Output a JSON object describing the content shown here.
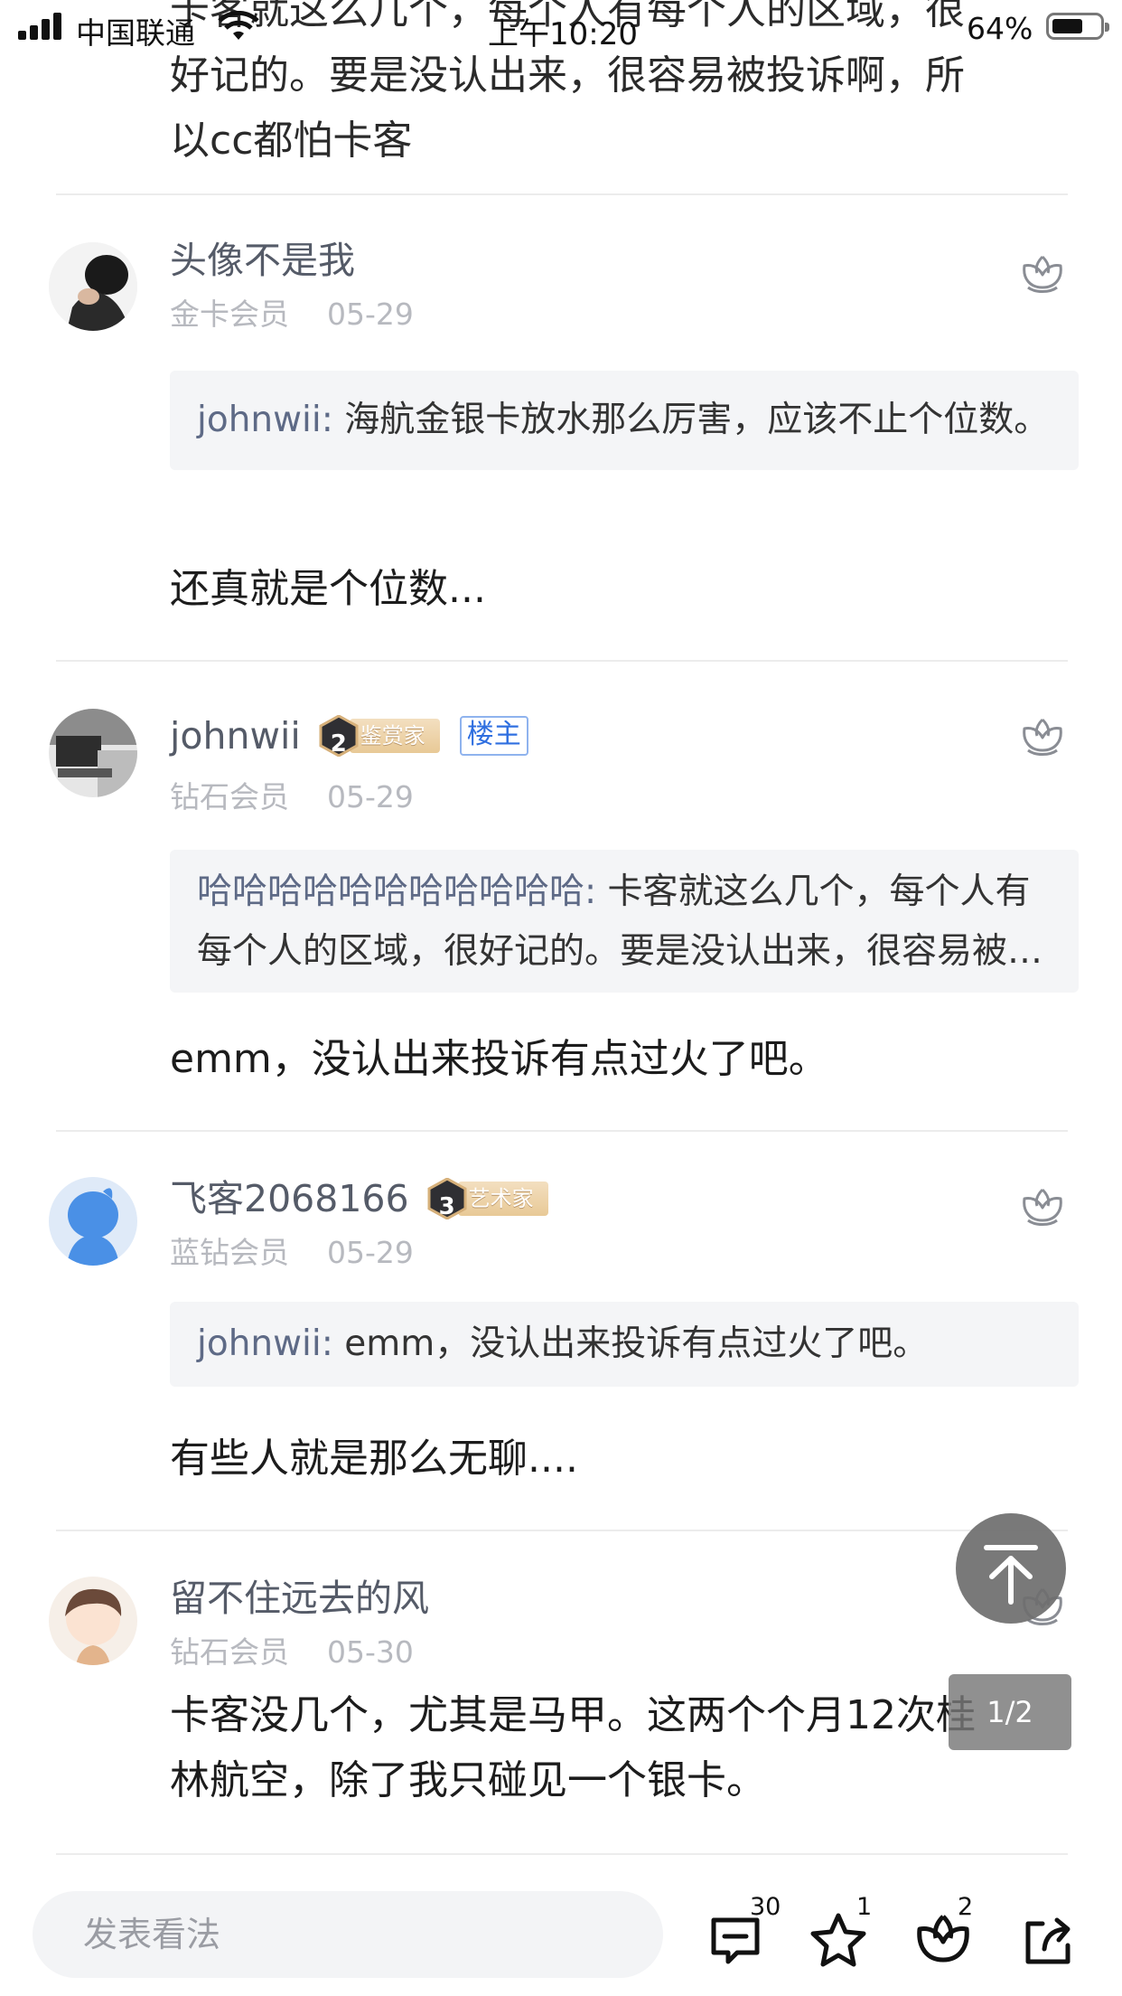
{
  "status_bar": {
    "carrier": "中国联通",
    "time": "上午10:20",
    "battery": "64%",
    "battery_level": 0.64
  },
  "top_fragment": {
    "line1": "卡客就这么几个，每个人有每个人的区域，很",
    "line2": "好记的。要是没认出来，很容易被投诉啊，所",
    "line3": "以cc都怕卡客"
  },
  "comments": [
    {
      "username": "头像不是我",
      "level": "金卡会员",
      "date": "05-29",
      "quote_name": "johnwii:",
      "quote_text": " 海航金银卡放水那么厉害，应该不止个位数。",
      "text": "还真就是个位数..."
    },
    {
      "username": "johnwii",
      "badge_number": "2",
      "badge_label": "鉴赏家",
      "owner_tag": "楼主",
      "level": "钻石会员",
      "date": "05-29",
      "quote_name": "哈哈哈哈哈哈哈哈哈哈哈:",
      "quote_text": " 卡客就这么几个，每个人有每个人的区域，很好记的。要是没认出来，很容易被投诉啊，所以cc都怕卡客",
      "text": "emm，没认出来投诉有点过火了吧。"
    },
    {
      "username": "飞客2068166",
      "badge_number": "3",
      "badge_label": "艺术家",
      "level": "蓝钻会员",
      "date": "05-29",
      "quote_name": "johnwii:",
      "quote_text": " emm，没认出来投诉有点过火了吧。",
      "text": "有些人就是那么无聊...."
    },
    {
      "username": "留不住远去的风",
      "level": "钻石会员",
      "date": "05-30",
      "text_line1": "卡客没几个，尤其是马甲。这两个个月12次桂",
      "text_line2": "林航空，除了我只碰见一个银卡。"
    }
  ],
  "page_indicator": "1/2",
  "bottom_bar": {
    "input_placeholder": "发表看法",
    "comment_count": "30",
    "star_count": "1",
    "like_count": "2"
  },
  "icons": {
    "like": "lotus-like-icon",
    "back_to_top": "arrow-up-to-top-icon",
    "comment": "comment-bubble-icon",
    "star": "star-icon",
    "share": "share-icon"
  },
  "colors": {
    "username": "#555b68",
    "meta": "#b7b9bf",
    "quote_bg": "#f4f5f7",
    "quote_name": "#5e6a86",
    "owner_tag": "#2f6fe0",
    "badge_gold": "#e8c996"
  }
}
